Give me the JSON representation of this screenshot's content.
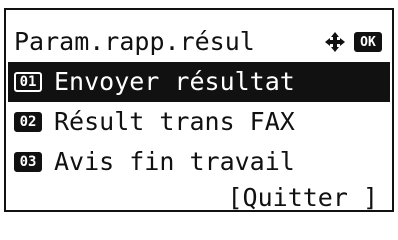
{
  "header": {
    "title": "Param.rapp.résul",
    "nav_icon": "four-way-arrow",
    "ok_label": "OK"
  },
  "menu": {
    "items": [
      {
        "number": "01",
        "label": "Envoyer résultat",
        "selected": true
      },
      {
        "number": "02",
        "label": "Résult trans FAX",
        "selected": false
      },
      {
        "number": "03",
        "label": "Avis fin travail",
        "selected": false
      }
    ],
    "quit_label": "[Quitter ]"
  }
}
